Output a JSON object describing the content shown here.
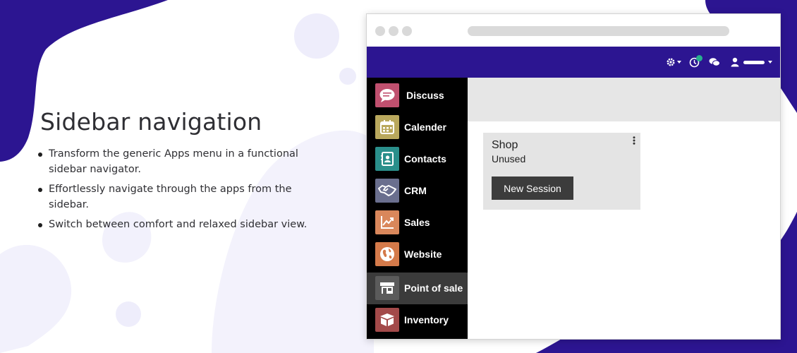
{
  "heading": "Sidebar navigation",
  "features": [
    "Transform the generic Apps menu in a functional sidebar navigator.",
    "Effortlessly navigate through the apps from the sidebar.",
    "Switch between comfort and relaxed sidebar view."
  ],
  "colors": {
    "accent": "#2c1591",
    "sidebar_bg": "#000000",
    "active_item": "#3b3b3b",
    "control_panel": "#e6e6e6",
    "card_bg": "#e4e4e4",
    "button_bg": "#3c3c3c",
    "badge": "#27b08e"
  },
  "navbar": {
    "icons": [
      "gear-icon",
      "clock-icon",
      "chat-icon",
      "user-icon"
    ],
    "activity_badge": "0"
  },
  "sidebar": {
    "items": [
      {
        "label": "Discuss",
        "icon": "chat-bubble-icon",
        "color": "#c0506f"
      },
      {
        "label": "Calender",
        "icon": "calendar-icon",
        "color": "#b9a85d"
      },
      {
        "label": "Contacts",
        "icon": "contact-card-icon",
        "color": "#2a8f8b"
      },
      {
        "label": "CRM",
        "icon": "handshake-icon",
        "color": "#6a6f8e"
      },
      {
        "label": "Sales",
        "icon": "trend-chart-icon",
        "color": "#d9875b"
      },
      {
        "label": "Website",
        "icon": "globe-icon",
        "color": "#d47a4a"
      },
      {
        "label": "Point of sale",
        "icon": "store-icon",
        "color": "#5b5b5b",
        "active": true
      },
      {
        "label": "Inventory",
        "icon": "box-icon",
        "color": "#a34a4a"
      }
    ]
  },
  "pos_card": {
    "title": "Shop",
    "status": "Unused",
    "button_label": "New Session"
  }
}
